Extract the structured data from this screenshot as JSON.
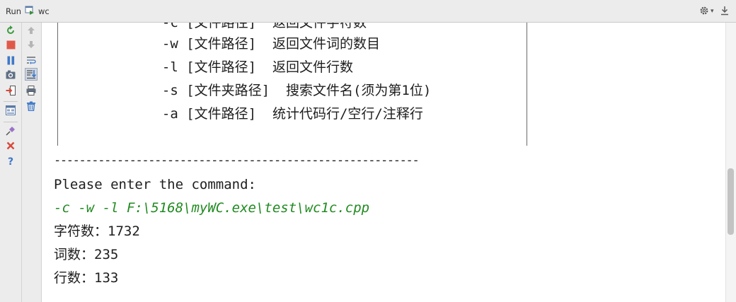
{
  "header": {
    "run_label": "Run",
    "tab_label": "wc",
    "tab_icon": "run-config-icon",
    "settings_icon": "gear-icon",
    "settings_arrow": "▾",
    "hide_icon": "hide-panel-icon"
  },
  "toolbar_primary": [
    {
      "icon": "rerun-icon"
    },
    {
      "icon": "stop-icon"
    },
    {
      "icon": "pause-icon"
    },
    {
      "icon": "dump-threads-icon"
    },
    {
      "icon": "exit-icon"
    },
    {
      "icon": "restore-layout-icon"
    },
    {
      "icon": "pin-icon"
    },
    {
      "icon": "close-icon"
    },
    {
      "icon": "help-icon"
    }
  ],
  "toolbar_secondary": [
    {
      "icon": "up-arrow-icon"
    },
    {
      "icon": "down-arrow-icon"
    },
    {
      "icon": "soft-wrap-icon"
    },
    {
      "icon": "scroll-to-end-icon",
      "active": true
    },
    {
      "icon": "print-icon"
    },
    {
      "icon": "clear-all-icon"
    }
  ],
  "console": {
    "lines": [
      "  -c [文件路径]  返回文件字符数",
      "  -w [文件路径]  返回文件词的数目",
      "  -l [文件路径]  返回文件行数",
      "  -s [文件夹路径]  搜索文件名(须为第1位)",
      "  -a [文件路径]  统计代码行/空行/注释行",
      "",
      "----------------------------------------------------------",
      "Please enter the command:",
      "-c -w -l F:\\5168\\myWC.exe\\test\\wc1c.cpp",
      "字符数：1732",
      "词数：235",
      "行数：133"
    ],
    "input_line_index": 8,
    "input_color": "#218a21",
    "text_color": "#1e1e1e"
  }
}
